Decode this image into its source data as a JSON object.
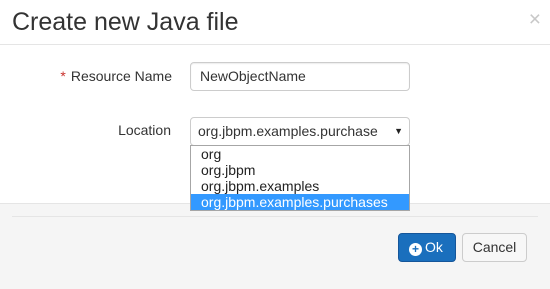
{
  "dialog": {
    "title": "Create new Java file",
    "close_glyph": "×"
  },
  "form": {
    "resource_name": {
      "required_marker": "*",
      "label": "Resource Name",
      "value": "NewObjectName"
    },
    "location": {
      "label": "Location",
      "selected": "org.jbpm.examples.purchase",
      "arrow_glyph": "▼",
      "options": [
        "org",
        "org.jbpm",
        "org.jbpm.examples",
        "org.jbpm.examples.purchases"
      ],
      "highlighted_index": 3
    }
  },
  "footer": {
    "ok_label": "Ok",
    "ok_icon": "plus-circle-icon",
    "cancel_label": "Cancel"
  },
  "colors": {
    "primary": "#1a6fbd",
    "required": "#c9302c",
    "option_highlight": "#3399ff"
  }
}
